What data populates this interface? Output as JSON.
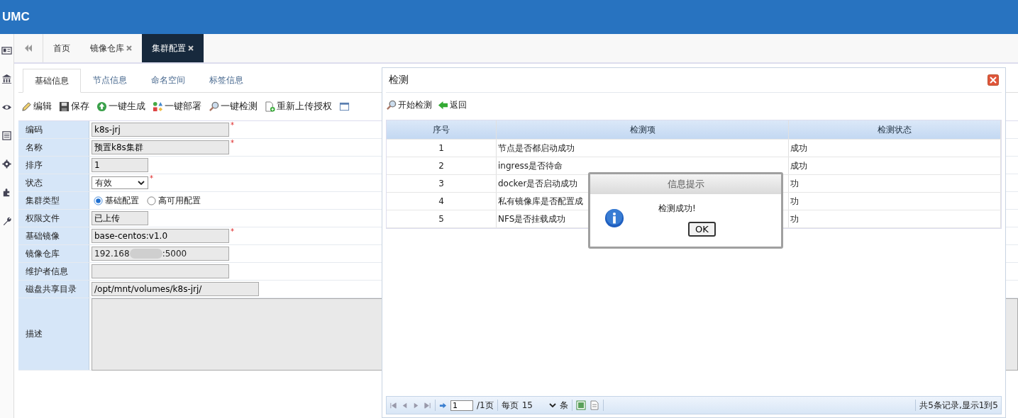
{
  "app": {
    "title": "UMC"
  },
  "sidebar": {
    "items": [
      {
        "kind": "card"
      },
      {
        "kind": "bank"
      },
      {
        "kind": "eye"
      },
      {
        "kind": "list"
      },
      {
        "kind": "gear"
      },
      {
        "kind": "puzzle"
      },
      {
        "kind": "wrench"
      }
    ]
  },
  "tabs": [
    {
      "label": "首页",
      "closable": false,
      "selected": false
    },
    {
      "label": "镜像仓库",
      "closable": true,
      "selected": false
    },
    {
      "label": "集群配置",
      "closable": true,
      "selected": true
    }
  ],
  "subtabs": [
    {
      "label": "基础信息",
      "selected": true
    },
    {
      "label": "节点信息",
      "selected": false
    },
    {
      "label": "命名空间",
      "selected": false
    },
    {
      "label": "标签信息",
      "selected": false
    }
  ],
  "toolbar": [
    {
      "kind": "edit",
      "label": "编辑"
    },
    {
      "kind": "save",
      "label": "保存"
    },
    {
      "kind": "generate",
      "label": "一键生成"
    },
    {
      "kind": "deploy",
      "label": "一键部署"
    },
    {
      "kind": "search",
      "label": "一键检测"
    },
    {
      "kind": "upload",
      "label": "重新上传授权"
    }
  ],
  "form": [
    {
      "label": "编码",
      "kind": "text",
      "value": "k8s-jrj",
      "required_mark": "*"
    },
    {
      "label": "名称",
      "kind": "text",
      "value": "预置k8s集群",
      "required_mark": "*"
    },
    {
      "label": "排序",
      "kind": "text",
      "value": "1"
    },
    {
      "label": "状态",
      "kind": "select",
      "value": "有效",
      "required_mark": "*"
    },
    {
      "label": "集群类型",
      "kind": "radio",
      "options": [
        {
          "label": "基础配置",
          "selected": true
        },
        {
          "label": "高可用配置",
          "selected": false
        }
      ]
    },
    {
      "label": "权限文件",
      "kind": "text",
      "value": "已上传"
    },
    {
      "label": "基础镜像",
      "kind": "text",
      "value": "base-centos:v1.0",
      "required_mark": "*"
    },
    {
      "label": "镜像仓库",
      "kind": "redacted",
      "value": "192.168",
      "value_end": ":5000"
    },
    {
      "label": "维护者信息",
      "kind": "text"
    },
    {
      "label": "磁盘共享目录",
      "kind": "text",
      "value": "/opt/mnt/volumes/k8s-jrj/"
    },
    {
      "label": "描述",
      "kind": "textarea"
    }
  ],
  "dialog": {
    "title": "检测",
    "toolbar": [
      {
        "kind": "search",
        "label": "开始检测"
      },
      {
        "kind": "back",
        "label": "返回"
      }
    ],
    "table": {
      "columns": [
        "序号",
        "检测项",
        "检测状态"
      ],
      "rows": [
        [
          "1",
          "节点是否都启动成功",
          "成功"
        ],
        [
          "2",
          "ingress是否待命",
          "成功"
        ],
        [
          "3",
          "docker是否启动成功",
          "功"
        ],
        [
          "4",
          "私有镜像库是否配置成",
          "功"
        ],
        [
          "5",
          "NFS是否挂载成功",
          "功"
        ]
      ]
    },
    "pager": {
      "page": "1",
      "pages": "/1页",
      "per_page_label": "每页",
      "per_page": "15",
      "per_page_unit": "条",
      "summary": "共5条记录,显示1到5"
    }
  },
  "message_box": {
    "title": "信息提示",
    "message": "检测成功!",
    "button": "OK"
  }
}
